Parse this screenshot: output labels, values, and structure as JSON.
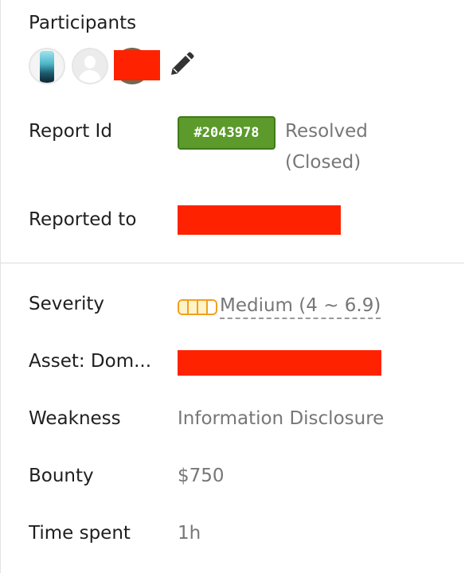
{
  "participants": {
    "label": "Participants",
    "avatars": [
      "avatar-hacker",
      "avatar-default",
      "avatar-redacted"
    ],
    "edit_icon": "pencil-icon"
  },
  "report": {
    "label": "Report Id",
    "id": "#2043978",
    "status_line1": "Resolved",
    "status_line2": "(Closed)"
  },
  "reported_to": {
    "label": "Reported to"
  },
  "severity": {
    "label": "Severity",
    "value": "Medium (4 ~ 6.9)",
    "level_filled": 3,
    "level_total": 4,
    "accent": "#f0a020"
  },
  "asset": {
    "label": "Asset: Dom..."
  },
  "weakness": {
    "label": "Weakness",
    "value": "Information Disclosure"
  },
  "bounty": {
    "label": "Bounty",
    "value": "$750"
  },
  "time_spent": {
    "label": "Time spent",
    "value": "1h"
  },
  "colors": {
    "badge_green": "#5b9a2b",
    "redaction": "#ff2200",
    "muted_text": "#777777"
  }
}
